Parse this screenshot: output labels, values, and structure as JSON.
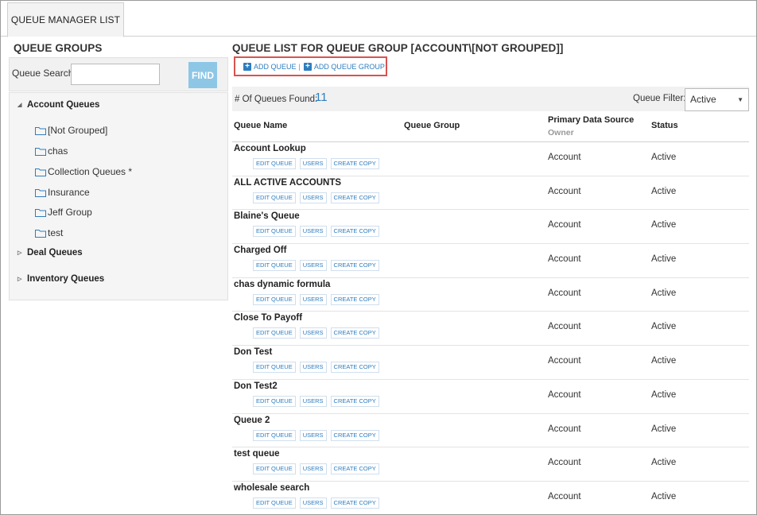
{
  "tabs": [
    {
      "label": "QUEUE MANAGER LIST"
    }
  ],
  "left": {
    "title": "QUEUE GROUPS",
    "search_label": "Queue Search:",
    "search_value": "",
    "search_placeholder": "",
    "find_label": "FIND",
    "groups": [
      {
        "label": "Account Queues",
        "expanded": true,
        "items": [
          "[Not Grouped]",
          "chas",
          "Collection Queues *",
          "Insurance",
          "Jeff Group",
          "test"
        ]
      },
      {
        "label": "Deal Queues",
        "expanded": false
      },
      {
        "label": "Inventory Queues",
        "expanded": false
      }
    ]
  },
  "right": {
    "title": "QUEUE LIST FOR QUEUE GROUP [ACCOUNT\\[NOT GROUPED]]",
    "add_queue_label": "ADD QUEUE",
    "separator": "|",
    "add_group_label": "ADD QUEUE GROUP",
    "found_label": "# Of Queues Found:",
    "found_count": "11",
    "filter_label": "Queue Filter:",
    "filter_value": "Active",
    "columns": {
      "name": "Queue Name",
      "group": "Queue Group",
      "source": "Primary Data Source",
      "owner": "Owner",
      "status": "Status"
    },
    "row_buttons": {
      "edit": "EDIT QUEUE",
      "users": "USERS",
      "copy": "CREATE COPY"
    },
    "rows": [
      {
        "name": "Account Lookup",
        "source": "Account",
        "status": "Active"
      },
      {
        "name": "ALL ACTIVE ACCOUNTS",
        "source": "Account",
        "status": "Active"
      },
      {
        "name": "Blaine's Queue",
        "source": "Account",
        "status": "Active"
      },
      {
        "name": "Charged Off",
        "source": "Account",
        "status": "Active"
      },
      {
        "name": "chas dynamic formula",
        "source": "Account",
        "status": "Active"
      },
      {
        "name": "Close To Payoff",
        "source": "Account",
        "status": "Active"
      },
      {
        "name": "Don Test",
        "source": "Account",
        "status": "Active"
      },
      {
        "name": "Don Test2",
        "source": "Account",
        "status": "Active"
      },
      {
        "name": "Queue 2",
        "source": "Account",
        "status": "Active"
      },
      {
        "name": "test queue",
        "source": "Account",
        "status": "Active"
      },
      {
        "name": "wholesale search",
        "source": "Account",
        "status": "Active"
      }
    ]
  },
  "colors": {
    "accent": "#2e7dbf",
    "find_button": "#8ec6e6",
    "highlight_border": "#d9534f"
  }
}
